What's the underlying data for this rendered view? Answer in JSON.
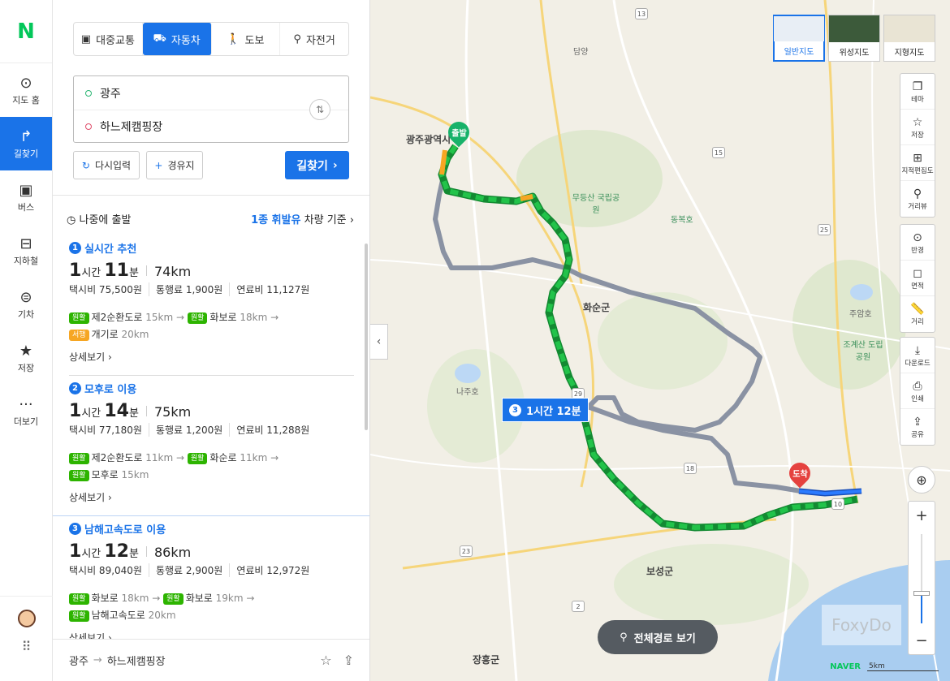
{
  "rail": {
    "logo": "N",
    "items": [
      {
        "label": "지도 홈",
        "icon": "map-home-icon",
        "glyph": "⊙"
      },
      {
        "label": "길찾기",
        "icon": "directions-icon",
        "glyph": "↱"
      },
      {
        "label": "버스",
        "icon": "bus-icon",
        "glyph": "▣"
      },
      {
        "label": "지하철",
        "icon": "subway-icon",
        "glyph": "⊟"
      },
      {
        "label": "기차",
        "icon": "train-icon",
        "glyph": "⊜"
      },
      {
        "label": "저장",
        "icon": "star-icon",
        "glyph": "★"
      },
      {
        "label": "더보기",
        "icon": "more-icon",
        "glyph": "···"
      }
    ]
  },
  "modes": [
    {
      "label": "대중교통",
      "glyph": "▣"
    },
    {
      "label": "자동차",
      "glyph": "⛟"
    },
    {
      "label": "도보",
      "glyph": "🚶"
    },
    {
      "label": "자전거",
      "glyph": "⚲"
    }
  ],
  "route_input": {
    "origin": "광주",
    "destination": "하느제캠핑장"
  },
  "buttons": {
    "reset": "다시입력",
    "via": "경유지",
    "search": "길찾기"
  },
  "depart_later": "나중에 출발",
  "vehicle": {
    "fuel": "1종 휘발유",
    "suffix": "차량 기준"
  },
  "routes": [
    {
      "num": "1",
      "title": "실시간 추천",
      "hours": "1",
      "hour_unit": "시간",
      "minutes": "11",
      "minute_unit": "분",
      "distance": "74km",
      "taxi": "택시비 75,500원",
      "toll": "통행료 1,900원",
      "fuel": "연료비 11,127원",
      "segments": [
        {
          "tag": "원활",
          "road": "제2순환도로",
          "dist": "15km",
          "tag2": "원활",
          "road2": "화보로",
          "dist2": "18km"
        },
        {
          "tag": "서행",
          "road": "개기로",
          "dist": "20km"
        }
      ],
      "detail": "상세보기"
    },
    {
      "num": "2",
      "title": "모후로 이용",
      "hours": "1",
      "hour_unit": "시간",
      "minutes": "14",
      "minute_unit": "분",
      "distance": "75km",
      "taxi": "택시비 77,180원",
      "toll": "통행료 1,200원",
      "fuel": "연료비 11,288원",
      "segments": [
        {
          "tag": "원활",
          "road": "제2순환도로",
          "dist": "11km",
          "tag2": "원활",
          "road2": "화순로",
          "dist2": "11km"
        },
        {
          "tag": "원활",
          "road": "모후로",
          "dist": "15km"
        }
      ],
      "detail": "상세보기"
    },
    {
      "num": "3",
      "title": "남해고속도로 이용",
      "hours": "1",
      "hour_unit": "시간",
      "minutes": "12",
      "minute_unit": "분",
      "distance": "86km",
      "taxi": "택시비 89,040원",
      "toll": "통행료 2,900원",
      "fuel": "연료비 12,972원",
      "segments": [
        {
          "tag": "원활",
          "road": "화보로",
          "dist": "18km",
          "tag2": "원활",
          "road2": "화보로",
          "dist2": "19km"
        },
        {
          "tag": "원활",
          "road": "남해고속도로",
          "dist": "20km"
        }
      ],
      "detail": "상세보기"
    }
  ],
  "bottom_bar": {
    "origin": "광주",
    "destination": "하느제캠핑장"
  },
  "map": {
    "types": [
      {
        "label": "일반지도",
        "active": true
      },
      {
        "label": "위성지도",
        "active": false
      },
      {
        "label": "지형지도",
        "active": false
      }
    ],
    "tools_top": [
      {
        "label": "테마",
        "icon": "theme-icon",
        "glyph": "❐"
      },
      {
        "label": "저장",
        "icon": "star-outline-icon",
        "glyph": "☆"
      },
      {
        "label": "지적편집도",
        "icon": "cadastral-icon",
        "glyph": "⊞"
      },
      {
        "label": "거리뷰",
        "icon": "street-view-icon",
        "glyph": "⚲"
      }
    ],
    "tools_mid": [
      {
        "label": "반경",
        "icon": "radius-icon",
        "glyph": "⊙"
      },
      {
        "label": "면적",
        "icon": "area-icon",
        "glyph": "◻"
      },
      {
        "label": "거리",
        "icon": "ruler-icon",
        "glyph": "📏"
      }
    ],
    "tools_bot": [
      {
        "label": "다운로드",
        "icon": "download-icon",
        "glyph": "⤓"
      },
      {
        "label": "인쇄",
        "icon": "print-icon",
        "glyph": "⎙"
      },
      {
        "label": "공유",
        "icon": "share-icon",
        "glyph": "⇪"
      }
    ],
    "full_route": "전체경로 보기",
    "route_badge": {
      "num": "3",
      "text": "1시간 12분"
    },
    "start_label": "출발",
    "end_label": "도착",
    "brand": "NAVER",
    "scale": "5km",
    "watermark": "FoxyDo",
    "places": [
      {
        "name": "광주광역시",
        "cls": ""
      },
      {
        "name": "화순군",
        "cls": ""
      },
      {
        "name": "보성군",
        "cls": ""
      },
      {
        "name": "장흥군",
        "cls": ""
      },
      {
        "name": "담양",
        "cls": "sm"
      },
      {
        "name": "무등산 국립공원",
        "cls": "green"
      },
      {
        "name": "동복호",
        "cls": "green"
      },
      {
        "name": "조계산 도립공원",
        "cls": "green"
      },
      {
        "name": "나주호",
        "cls": "sm"
      },
      {
        "name": "주암호",
        "cls": "sm"
      }
    ],
    "shields": [
      "13",
      "15",
      "29",
      "18",
      "23",
      "10",
      "25",
      "2"
    ],
    "colors": {
      "accent": "#1a73e8",
      "route_main": "#22b14c",
      "route_alt": "#8a92a3",
      "brand": "#03c75a"
    }
  }
}
